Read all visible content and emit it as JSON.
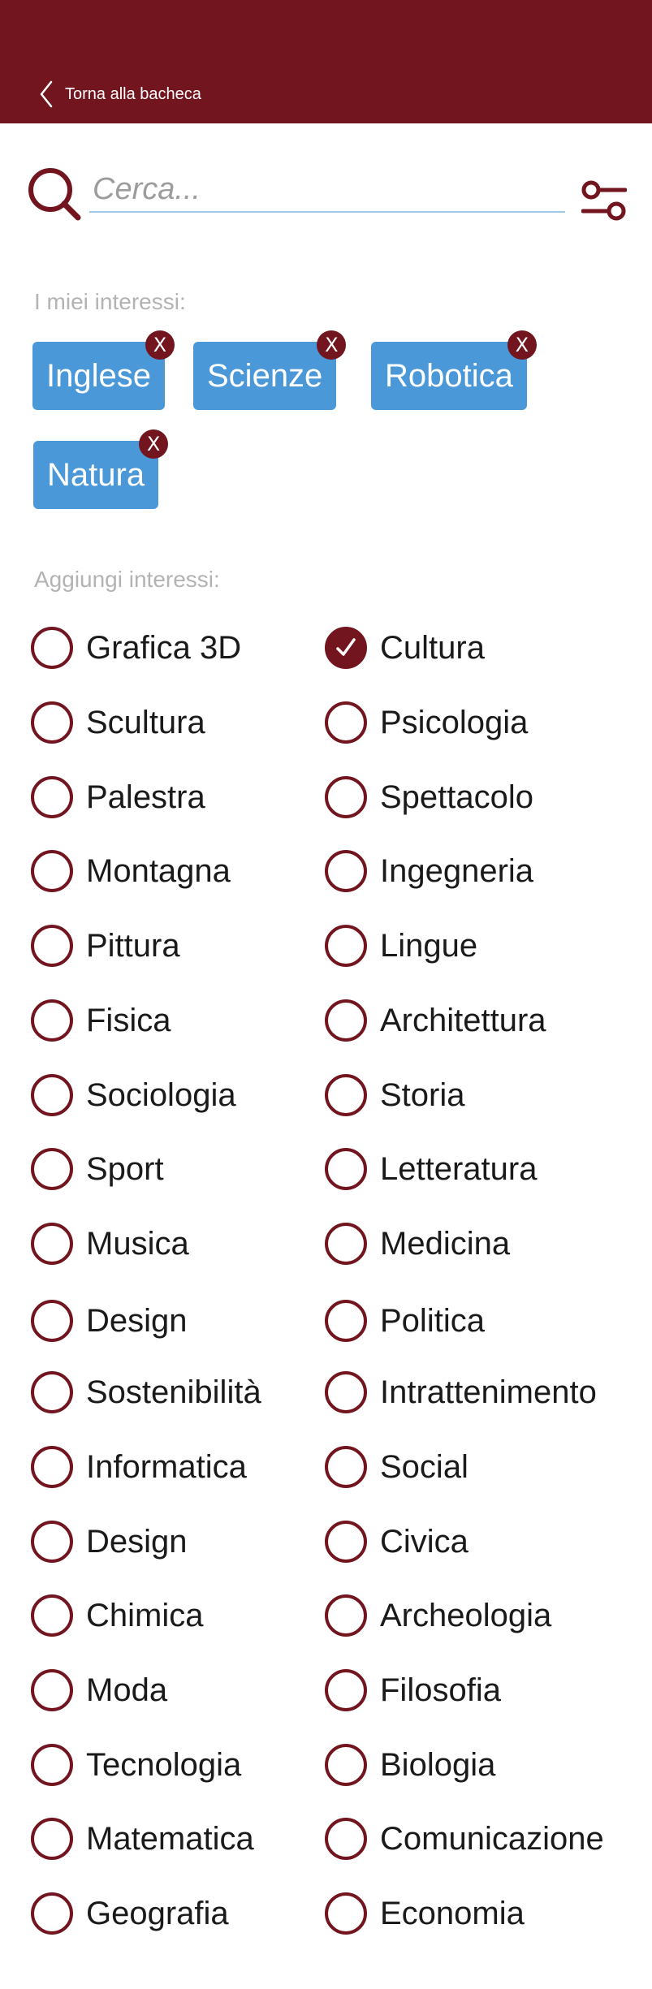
{
  "header": {
    "back_label": "Torna alla bacheca",
    "back_icon": "chevron-left-icon",
    "color": "#72151e"
  },
  "search": {
    "placeholder": "Cerca...",
    "value": "",
    "search_icon": "search-icon",
    "filter_icon": "filter-icon"
  },
  "my_interests": {
    "label": "I miei interessi:",
    "chips": [
      {
        "label": "Inglese",
        "remove": "X"
      },
      {
        "label": "Scienze",
        "remove": "X"
      },
      {
        "label": "Robotica",
        "remove": "X"
      },
      {
        "label": "Natura",
        "remove": "X"
      }
    ],
    "chip_color": "#4a98d8"
  },
  "add_interests": {
    "label": "Aggiungi interessi:",
    "rows": [
      [
        {
          "label": "Grafica 3D",
          "checked": false
        },
        {
          "label": "Cultura",
          "checked": true
        }
      ],
      [
        {
          "label": "Scultura",
          "checked": false
        },
        {
          "label": "Psicologia",
          "checked": false
        }
      ],
      [
        {
          "label": "Palestra",
          "checked": false
        },
        {
          "label": "Spettacolo",
          "checked": false
        }
      ],
      [
        {
          "label": "Montagna",
          "checked": false
        },
        {
          "label": "Ingegneria",
          "checked": false
        }
      ],
      [
        {
          "label": "Pittura",
          "checked": false
        },
        {
          "label": "Lingue",
          "checked": false
        }
      ],
      [
        {
          "label": "Fisica",
          "checked": false
        },
        {
          "label": "Architettura",
          "checked": false
        }
      ],
      [
        {
          "label": "Sociologia",
          "checked": false
        },
        {
          "label": "Storia",
          "checked": false
        }
      ],
      [
        {
          "label": "Sport",
          "checked": false
        },
        {
          "label": "Letteratura",
          "checked": false
        }
      ],
      [
        {
          "label": "Musica",
          "checked": false
        },
        {
          "label": "Medicina",
          "checked": false
        }
      ],
      [
        {
          "label": "Design",
          "checked": false
        },
        {
          "label": "Politica",
          "checked": false
        }
      ],
      [
        {
          "label": "Sostenibilità",
          "checked": false
        },
        {
          "label": "Intrattenimento",
          "checked": false
        }
      ],
      [
        {
          "label": "Informatica",
          "checked": false
        },
        {
          "label": "Social",
          "checked": false
        }
      ],
      [
        {
          "label": "Design",
          "checked": false
        },
        {
          "label": "Civica",
          "checked": false
        }
      ],
      [
        {
          "label": "Chimica",
          "checked": false
        },
        {
          "label": "Archeologia",
          "checked": false
        }
      ],
      [
        {
          "label": "Moda",
          "checked": false
        },
        {
          "label": "Filosofia",
          "checked": false
        }
      ],
      [
        {
          "label": "Tecnologia",
          "checked": false
        },
        {
          "label": "Biologia",
          "checked": false
        }
      ],
      [
        {
          "label": "Matematica",
          "checked": false
        },
        {
          "label": "Comunicazione",
          "checked": false
        }
      ],
      [
        {
          "label": "Geografia",
          "checked": false
        },
        {
          "label": "Economia",
          "checked": false
        }
      ]
    ],
    "accent_color": "#72151e"
  }
}
